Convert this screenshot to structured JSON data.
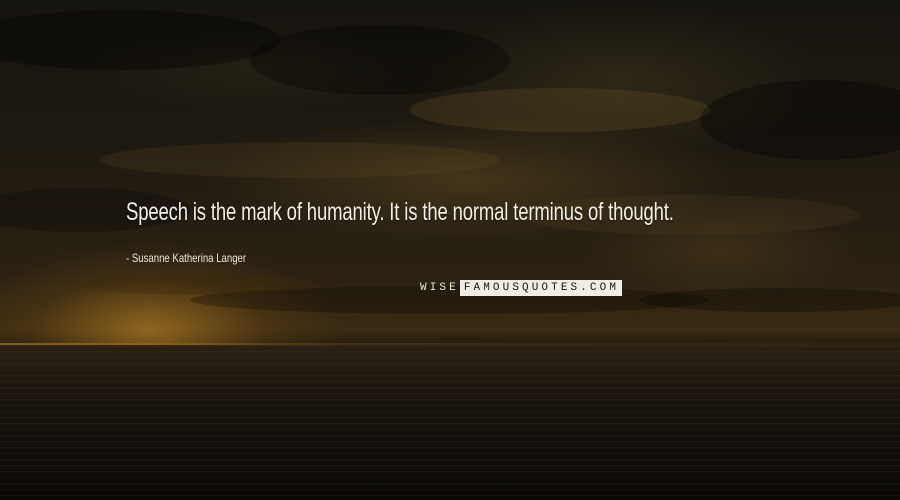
{
  "quote": {
    "text": "Speech is the mark of humanity. It is the normal terminus of thought.",
    "author": "- Susanne Katherina Langer"
  },
  "watermark": {
    "prefix": "WISE",
    "boxed": "FAMOUSQUOTES.COM"
  },
  "colors": {
    "text": "#f3efe6",
    "sky": "#1f1a11",
    "sun_glow": "#d69628",
    "sea": "#100e0b"
  }
}
